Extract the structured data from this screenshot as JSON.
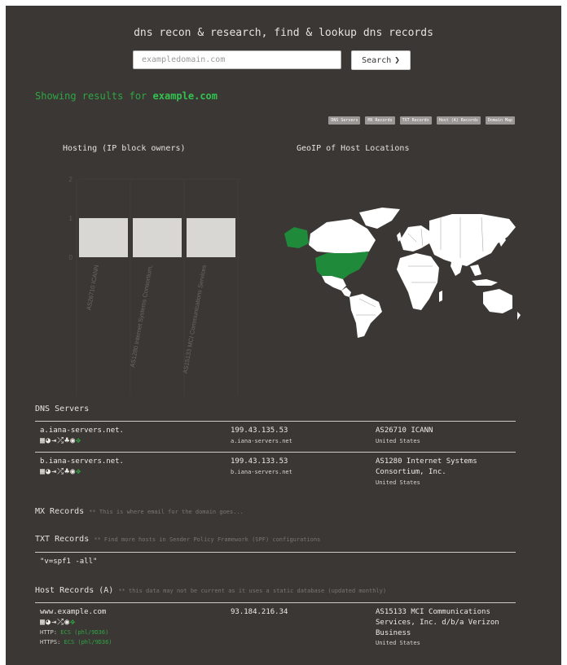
{
  "header": {
    "title": "dns recon & research, find & lookup dns records",
    "search_placeholder": "exampledomain.com",
    "search_button": "Search"
  },
  "results": {
    "prefix": "Showing results for",
    "domain": "example.com"
  },
  "nav_buttons": [
    "DNS Servers",
    "MX Records",
    "TXT Records",
    "Host (A) Records",
    "Domain Map"
  ],
  "hosting": {
    "title": "Hosting (IP block owners)"
  },
  "geoip": {
    "title": "GeoIP of Host Locations"
  },
  "chart_data": {
    "type": "bar",
    "title": "Hosting (IP block owners)",
    "categories": [
      "AS26710 ICANN",
      "AS1280 Internet Systems Consortium,",
      "AS15133 MCI Communications Services"
    ],
    "values": [
      1,
      1,
      1
    ],
    "yticks": [
      "0",
      "1",
      "2"
    ],
    "ylim": [
      0,
      2
    ],
    "bar_color": "#d9d7d4"
  },
  "dns_servers": {
    "title": "DNS Servers",
    "rows": [
      {
        "host": "a.iana-servers.net.",
        "ip": "199.43.135.53",
        "rdns": "a.iana-servers.net",
        "asn_line1": "AS26710 ICANN",
        "asn_line2": "",
        "country": "United States"
      },
      {
        "host": "b.iana-servers.net.",
        "ip": "199.43.133.53",
        "rdns": "b.iana-servers.net",
        "asn_line1": "AS1280 Internet Systems",
        "asn_line2": "Consortium, Inc.",
        "country": "United States"
      }
    ]
  },
  "mx": {
    "title": "MX Records",
    "hint": "** This is where email for the domain goes..."
  },
  "txt": {
    "title": "TXT Records",
    "hint": "** Find more hosts in Sender Policy Framework (SPF) configurations",
    "value": "\"v=spf1 -all\""
  },
  "host_records": {
    "title": "Host Records (A)",
    "hint": "** this data may not be current as it uses a static database (updated monthly)",
    "host": "www.example.com",
    "ip": "93.184.216.34",
    "asn_line1": "AS15133 MCI Communications",
    "asn_line2": "Services, Inc. d/b/a Verizon",
    "asn_line3": "Business",
    "country": "United States",
    "http_label": "HTTP:",
    "http_value": "ECS (phl/9D36)",
    "https_label": "HTTPS:",
    "https_value": "ECS (phl/9D36)"
  },
  "map": {
    "highlight_color": "#1f8a3a",
    "land_color": "#ffffff"
  }
}
